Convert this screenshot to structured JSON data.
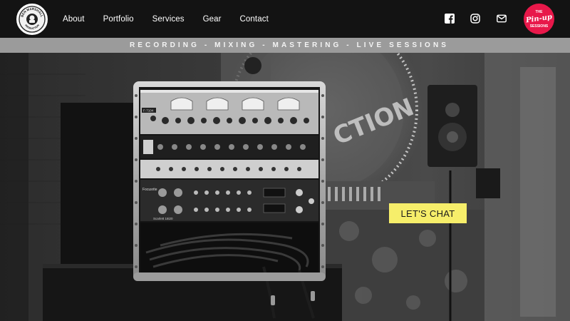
{
  "header": {
    "logo_text_top": "BEN MARSHALL",
    "logo_text_bottom": "PRODUCTION",
    "nav": [
      "About",
      "Portfolio",
      "Services",
      "Gear",
      "Contact"
    ],
    "social_icons": [
      "facebook-icon",
      "instagram-icon",
      "mail-icon"
    ],
    "badge": {
      "line1": "THE",
      "line2": "Pin-up",
      "line3": "SESSIONS"
    }
  },
  "tagline": "RECORDING - MIXING - MASTERING - LIVE SESSIONS",
  "hero": {
    "cta_label": "LET'S CHAT",
    "background_text": "CTION",
    "rack_labels": [
      "F-7104",
      "Focusrite",
      "Scarlett 18i20"
    ]
  },
  "colors": {
    "topbar": "#131313",
    "strip": "#9b9b9b",
    "cta": "#f6ee6a",
    "badge": "#e8184a"
  }
}
